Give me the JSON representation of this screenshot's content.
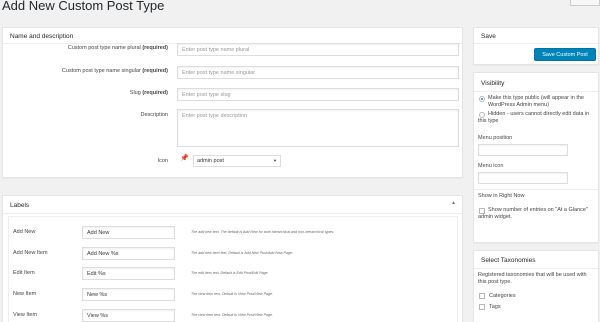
{
  "page": {
    "title": "Add New Custom Post Type"
  },
  "name_desc": {
    "heading": "Name and description",
    "fields": [
      {
        "label": "Custom post type name plural",
        "required": "(required)",
        "placeholder": "Enter post type name plural"
      },
      {
        "label": "Custom post type name singular",
        "required": "(required)",
        "placeholder": "Enter post type name singular"
      },
      {
        "label": "Slug",
        "required": "(required)",
        "placeholder": "Enter post type slug"
      },
      {
        "label": "Description",
        "required": "",
        "placeholder": "Enter post type description"
      }
    ],
    "icon_label": "Icon",
    "icon_value": "admin post"
  },
  "labels": {
    "heading": "Labels",
    "rows": [
      {
        "label": "Add New",
        "value": "Add New",
        "hint": "The add new text. The default is Add New for both hierarchical and non-hierarchical types."
      },
      {
        "label": "Add New Item",
        "value": "Add New %s",
        "hint": "The add new item text. Default is Add New Post/Add New Page."
      },
      {
        "label": "Edit Item",
        "value": "Edit %s",
        "hint": "The edit item text. Default is Edit Post/Edit Page."
      },
      {
        "label": "New Item",
        "value": "New %s",
        "hint": "The view item text. Default is View Post/View Page."
      },
      {
        "label": "View Item",
        "value": "View %s",
        "hint": "The view item text. Default is View Post/View Page."
      }
    ]
  },
  "save": {
    "heading": "Save",
    "button": "Save Custom Post"
  },
  "visibility": {
    "heading": "Visibility",
    "public_option": "Make this type public (will appear in the WordPress Admin menu)",
    "hidden_option": "Hidden - users cannot directly edit data in this type",
    "menu_position_label": "Menu position",
    "menu_icon_label": "Menu icon",
    "right_now_label": "Show in Right Now",
    "right_now_option": "Show number of entries on \"At a Glance\" admin widget."
  },
  "taxonomies": {
    "heading": "Select Taxonomies",
    "description": "Registered taxonomies that will be used with this post type.",
    "items": [
      "Categories",
      "Tags"
    ]
  },
  "colors": {
    "accent": "#0085ba",
    "background": "#f1f1f1"
  }
}
